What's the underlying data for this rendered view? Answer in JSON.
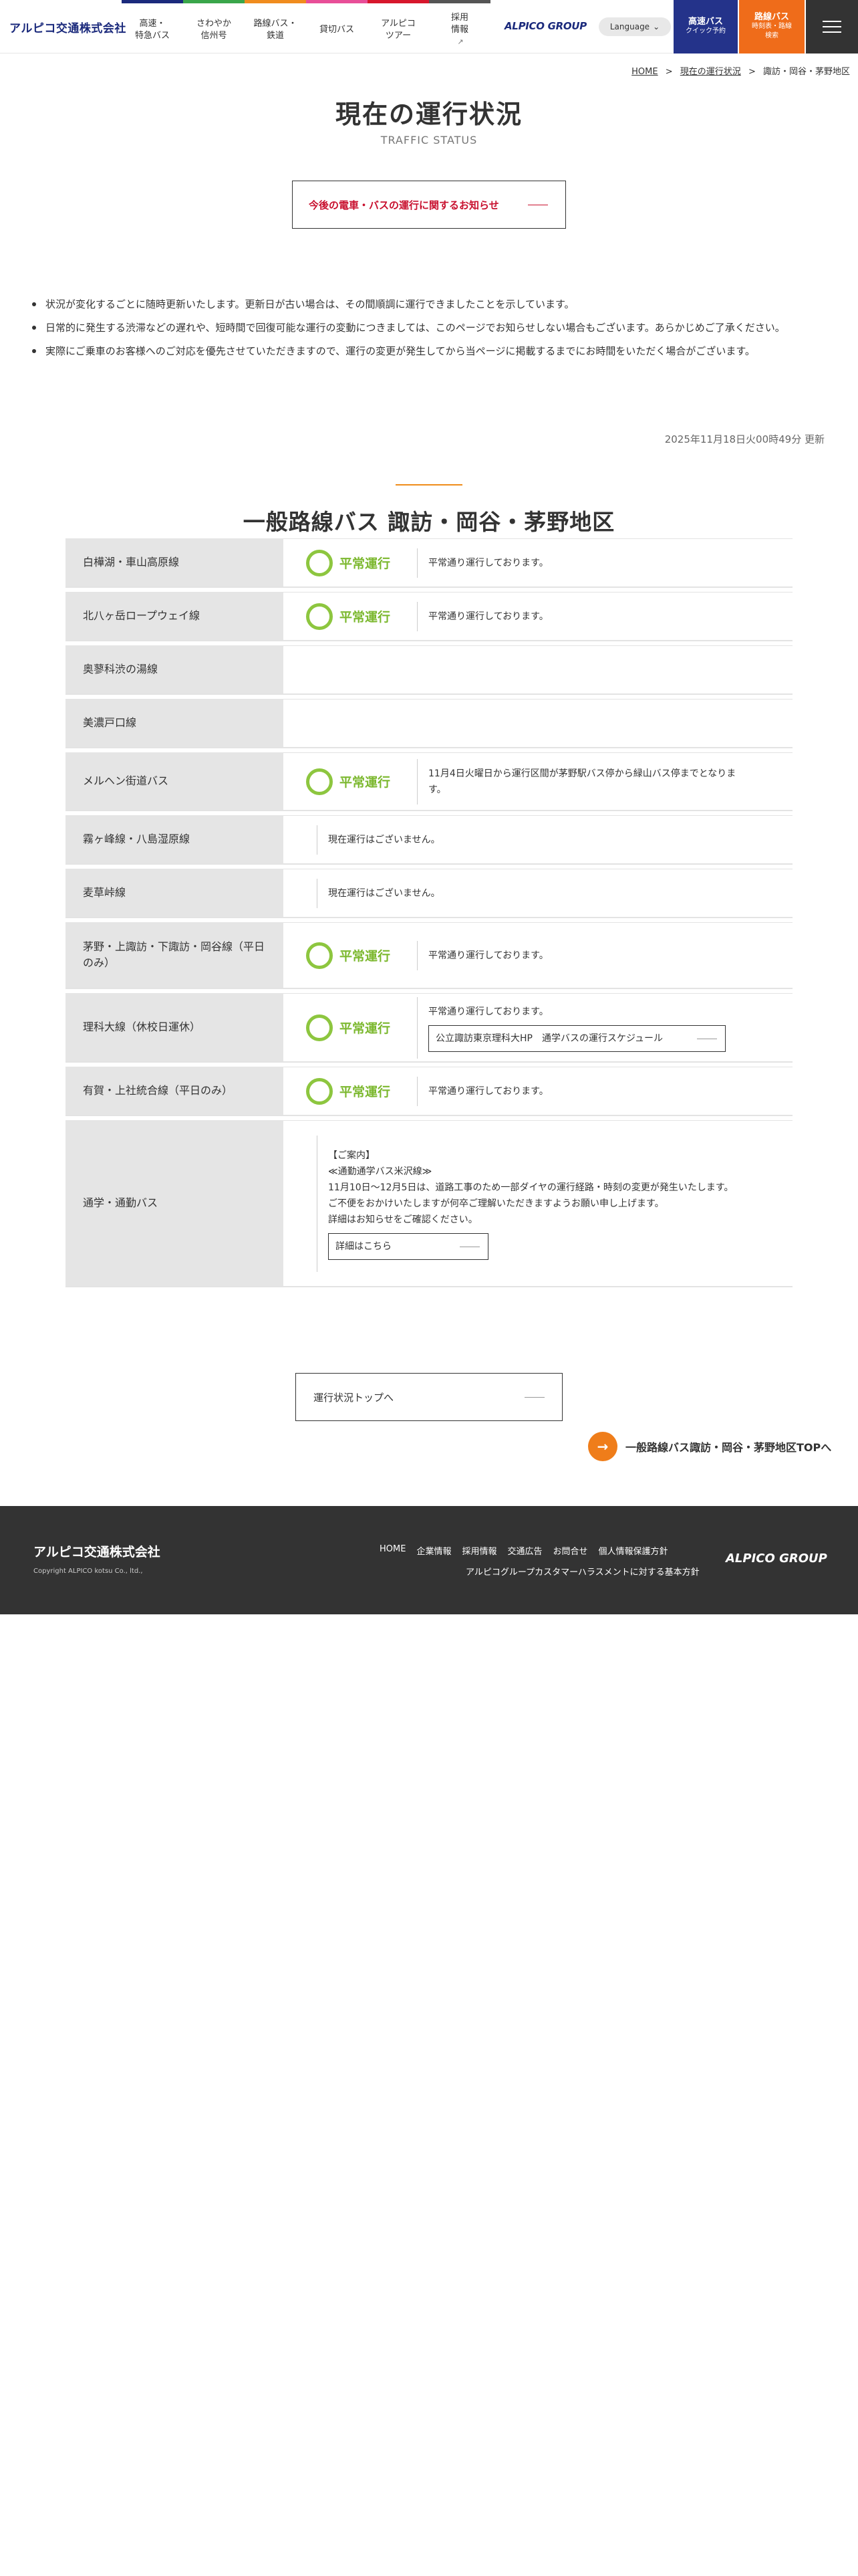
{
  "header": {
    "logo": "アルピコ交通株式会社",
    "nav": [
      {
        "line1": "高速・",
        "line2": "特急バス",
        "color": "#1b2a7c"
      },
      {
        "line1": "さわやか",
        "line2": "信州号",
        "color": "#3aa64a"
      },
      {
        "line1": "路線バス・",
        "line2": "鉄道",
        "color": "#f08c1e"
      },
      {
        "line1": "貸切バス",
        "line2": "",
        "color": "#e84e98"
      },
      {
        "line1": "アルピコ",
        "line2": "ツアー",
        "color": "#d7162c"
      },
      {
        "line1": "採用",
        "line2": "情報",
        "color": "#555555"
      }
    ],
    "brand": "ALPICO GROUP",
    "language": "Language",
    "highway_btn": {
      "title": "高速バス",
      "sub": "クイック予約"
    },
    "route_btn": {
      "title": "路線バス",
      "sub1": "時刻表・路線",
      "sub2": "検索"
    }
  },
  "breadcrumb": {
    "home": "HOME",
    "status": "現在の運行状況",
    "current": "諏訪・岡谷・茅野地区"
  },
  "title": "現在の運行状況",
  "subtitle": "TRAFFIC STATUS",
  "notice_button": "今後の電車・バスの運行に関するお知らせ",
  "notes": [
    "状況が変化するごとに随時更新いたします。更新日が古い場合は、その間順調に運行できましたことを示しています。",
    "日常的に発生する渋滞などの遅れや、短時間で回復可能な運行の変動につきましては、このページでお知らせしない場合もございます。あらかじめご了承ください。",
    "実際にご乗車のお客様へのご対応を優先させていただきますので、運行の変更が発生してから当ページに掲載するまでにお時間をいただく場合がございます。"
  ],
  "updated": "2025年11月18日火00時49分 更新",
  "section_title": "一般路線バス 諏訪・岡谷・茅野地区",
  "routes": [
    {
      "name": "白樺湖・車山高原線",
      "status": "平常運行",
      "desc": "平常通り運行しております。"
    },
    {
      "name": "北八ヶ岳ロープウェイ線",
      "status": "平常運行",
      "desc": "平常通り運行しております。"
    },
    {
      "name": "奥蓼科渋の湯線"
    },
    {
      "name": "美濃戸口線"
    },
    {
      "name": "メルヘン街道バス",
      "status": "平常運行",
      "desc1": "11月4日火曜日から運行区間が茅野駅バス停から緑山バス停までとなりま",
      "desc2": "す。"
    },
    {
      "name": "霧ヶ峰線・八島湿原線",
      "desc": "現在運行はございません。"
    },
    {
      "name": "麦草峠線",
      "desc": "現在運行はございません。"
    },
    {
      "name1": "茅野・上諏訪・下諏訪・岡谷線（平日",
      "name2": "のみ）",
      "status": "平常運行",
      "desc": "平常通り運行しております。"
    },
    {
      "name": "理科大線（休校日運休）",
      "status": "平常運行",
      "desc": "平常通り運行しております。",
      "button": "公立諏訪東京理科大HP　通学バスの運行スケジュール"
    },
    {
      "name": "有賀・上社統合線（平日のみ）",
      "status": "平常運行",
      "desc": "平常通り運行しております。"
    },
    {
      "name": "通学・通勤バス",
      "lines": [
        "【ご案内】",
        "≪通勤通学バス米沢線≫",
        "11月10日～12月5日は、道路工事のため一部ダイヤの運行経路・時刻の変更が発生いたします。",
        "ご不便をおかけいたしますが何卒ご理解いただきますようお願い申し上げます。",
        "詳細はお知らせをご確認ください。"
      ],
      "button": "詳細はこちら"
    }
  ],
  "top_button": "運行状況トップへ",
  "area_top_link": "一般路線バス諏訪・岡谷・茅野地区TOPへ",
  "footer": {
    "logo": "アルピコ交通株式会社",
    "copyright": "Copyright ALPICO kotsu Co., ltd.,",
    "links": [
      "HOME",
      "企業情報",
      "採用情報",
      "交通広告",
      "お問合せ",
      "個人情報保護方針"
    ],
    "link2": "アルピコグループカスタマーハラスメントに対する基本方針",
    "brand": "ALPICO GROUP"
  },
  "colors": {
    "accent_orange": "#ef7d1a",
    "status_green": "#8dc63f",
    "navy": "#1b2a7c",
    "notice_red": "#c8102e"
  }
}
